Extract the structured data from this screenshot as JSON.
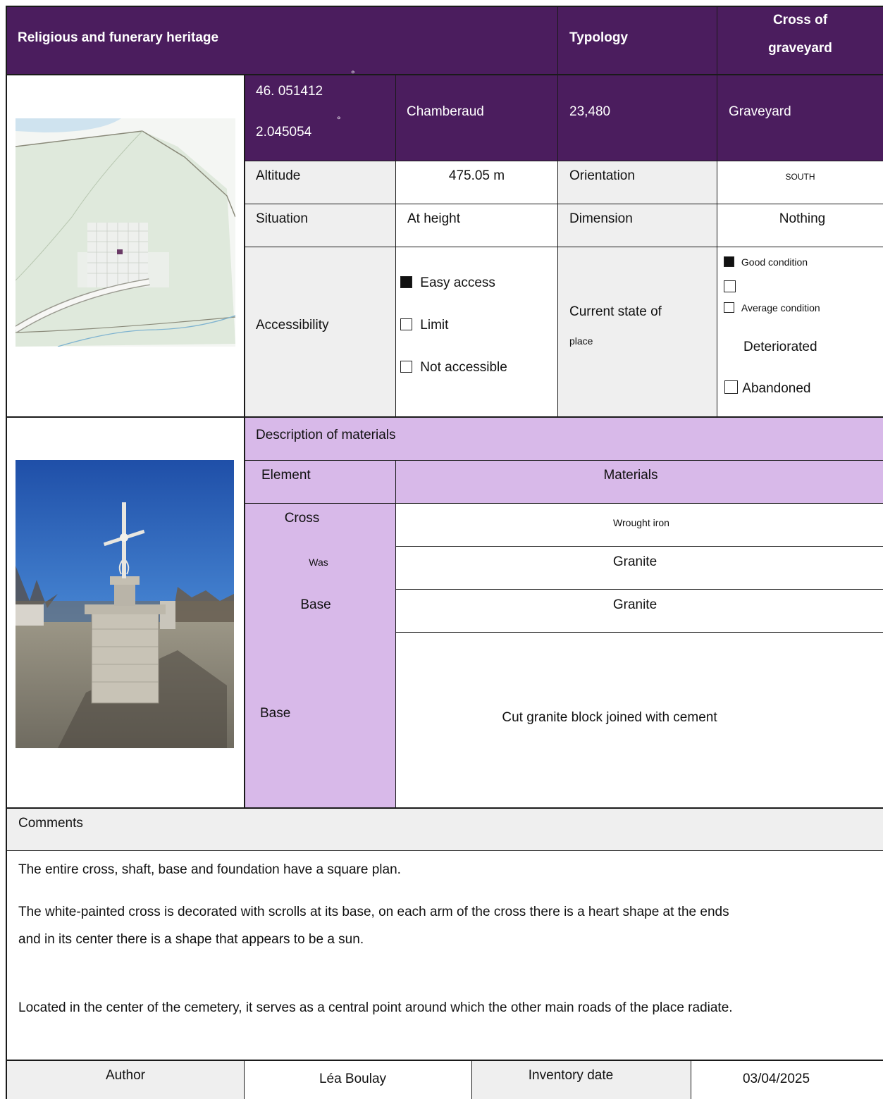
{
  "header": {
    "title": "Religious and funerary heritage",
    "typology_label": "Typology",
    "typology_value_line1": "Cross of",
    "typology_value_line2": "graveyard"
  },
  "location": {
    "latitude": "46. 051412",
    "longitude": "2.045054",
    "degree_symbol": "°",
    "commune": "Chamberaud",
    "postcode": "23,480",
    "place": "Graveyard"
  },
  "attributes": {
    "altitude_label": "Altitude",
    "altitude_value": "475.05 m",
    "orientation_label": "Orientation",
    "orientation_value": "SOUTH",
    "situation_label": "Situation",
    "situation_value": "At height",
    "dimension_label": "Dimension",
    "dimension_value": "Nothing"
  },
  "accessibility": {
    "label": "Accessibility",
    "options": [
      {
        "label": "Easy access",
        "checked": true
      },
      {
        "label": "Limit",
        "checked": false
      },
      {
        "label": "Not accessible",
        "checked": false
      }
    ]
  },
  "state": {
    "label_line1": "Current state of",
    "label_line2": "place",
    "good": "Good condition",
    "average": "Average condition",
    "deteriorated": "Deteriorated",
    "abandoned": "Abandoned"
  },
  "materials": {
    "section_title": "Description of materials",
    "col_element": "Element",
    "col_materials": "Materials",
    "rows": [
      {
        "element": "Cross",
        "material": "Wrought iron"
      },
      {
        "element": "Was",
        "material": "Granite"
      },
      {
        "element": "Base",
        "material": "Granite"
      },
      {
        "element": "Base",
        "material": "Cut granite block joined with cement"
      }
    ]
  },
  "comments": {
    "label": "Comments",
    "p1": "The entire cross, shaft, base and foundation have a square plan.",
    "p2a": "The white-painted cross is decorated with scrolls at its base, on each arm of the cross there is a heart shape at the ends",
    "p2b": "and in its center there is a shape that appears to be a sun.",
    "p3": "Located in the center of the cemetery, it serves as a central point around which the other main roads of the place radiate."
  },
  "footer": {
    "author_label": "Author",
    "author_value": "Léa Boulay",
    "date_label": "Inventory date",
    "date_value": "03/04/2025"
  },
  "colors": {
    "header_purple": "#4b1d5e",
    "lilac": "#d8b9e9",
    "label_grey": "#efefef"
  }
}
